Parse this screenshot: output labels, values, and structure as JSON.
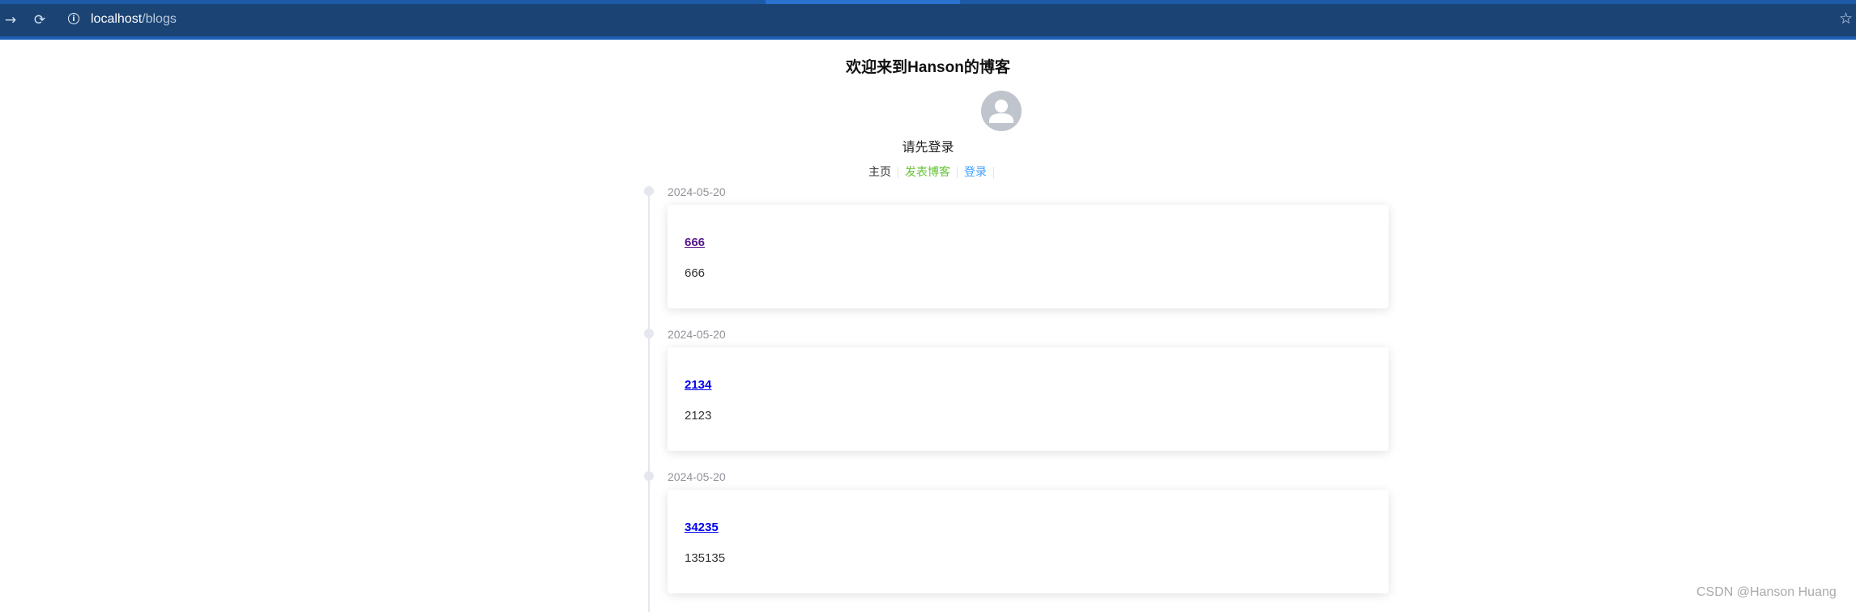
{
  "browser": {
    "url_host": "localhost",
    "url_path": "/blogs",
    "back_icon": "arrow-right-icon",
    "reload_icon": "reload-icon",
    "info_icon": "info-icon",
    "star_icon": "star-icon"
  },
  "header": {
    "title": "欢迎来到Hanson的博客",
    "login_hint": "请先登录"
  },
  "menu": {
    "home": "主页",
    "post": "发表博客",
    "login": "登录"
  },
  "posts": [
    {
      "date": "2024-05-20",
      "title": "666",
      "content": "666",
      "visited": true
    },
    {
      "date": "2024-05-20",
      "title": "2134",
      "content": "2123",
      "visited": false
    },
    {
      "date": "2024-05-20",
      "title": "34235",
      "content": "135135",
      "visited": false
    }
  ],
  "watermark": "CSDN @Hanson Huang",
  "colors": {
    "browser_bar": "#1b4475",
    "post_link": "#67c23a",
    "login_link": "#409eff",
    "visited_link": "#551a8b",
    "link": "#0000ee"
  }
}
